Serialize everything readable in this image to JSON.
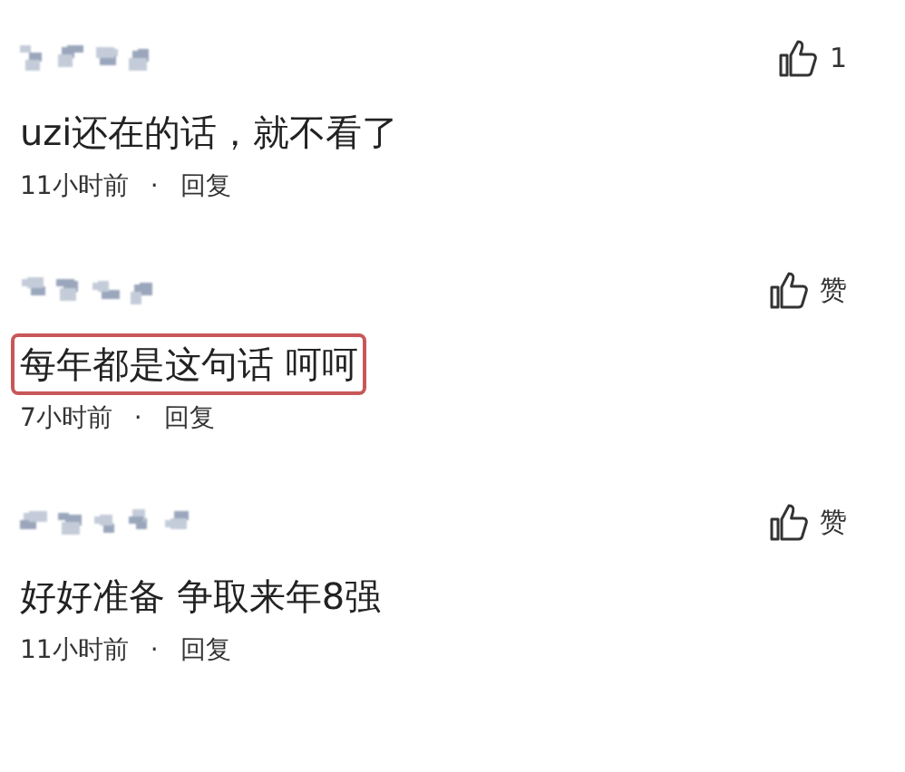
{
  "comments": [
    {
      "text": "uzi还在的话，就不看了",
      "time": "11小时前",
      "separator": "·",
      "reply": "回复",
      "like_label": "1",
      "highlighted": false
    },
    {
      "text": "每年都是这句话 呵呵",
      "time": "7小时前",
      "separator": "·",
      "reply": "回复",
      "like_label": "赞",
      "highlighted": true
    },
    {
      "text": "好好准备 争取来年8强",
      "time": "11小时前",
      "separator": "·",
      "reply": "回复",
      "like_label": "赞",
      "highlighted": false
    }
  ]
}
